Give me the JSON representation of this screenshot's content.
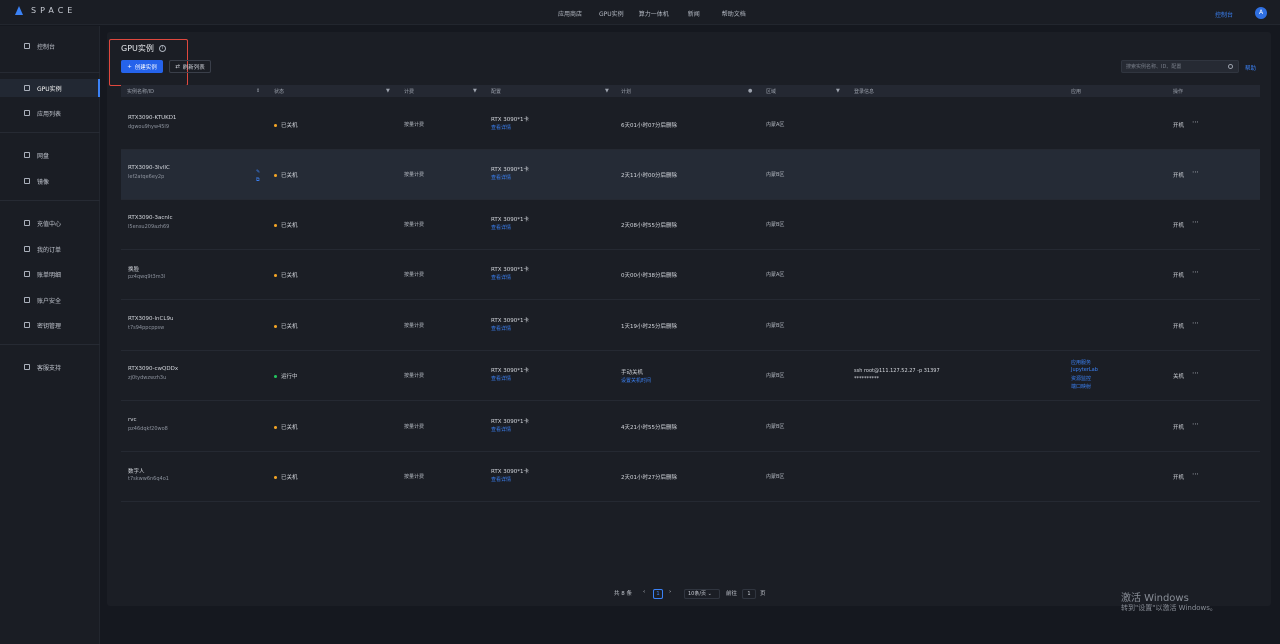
{
  "app": {
    "logo_text": "SPACE",
    "console_label": "控制台",
    "avatar_letter": "A"
  },
  "topnav": [
    "应用商店",
    "GPU实例",
    "算力一体机",
    "新闻",
    "帮助文档"
  ],
  "sidebar": {
    "items": [
      {
        "label": "控制台",
        "icon": "dashboard-icon"
      },
      {
        "label": "GPU实例",
        "icon": "gpu-icon"
      },
      {
        "label": "应用列表",
        "icon": "app-list-icon"
      },
      {
        "label": "网盘",
        "icon": "cloud-disk-icon"
      },
      {
        "label": "镜像",
        "icon": "image-icon"
      },
      {
        "label": "充值中心",
        "icon": "recharge-icon"
      },
      {
        "label": "我的订单",
        "icon": "order-icon"
      },
      {
        "label": "账单明细",
        "icon": "bill-icon"
      },
      {
        "label": "账户安全",
        "icon": "security-icon"
      },
      {
        "label": "密钥管理",
        "icon": "key-icon"
      },
      {
        "label": "客服支持",
        "icon": "support-icon"
      }
    ]
  },
  "page": {
    "title": "GPU实例",
    "create_label": "创建实例",
    "refresh_label": "刷新列表",
    "search_placeholder": "搜索实例名称、ID、配置",
    "help_label": "帮助"
  },
  "table": {
    "headers": [
      "实例名称/ID",
      "状态",
      "计费",
      "配置",
      "计划",
      "区域",
      "登录信息",
      "应用",
      "操作"
    ],
    "rows": [
      {
        "name": "RTX3090-KTUKD1",
        "id": "dgwou9hyw45l9",
        "status": "已关机",
        "status_color": "#f5a524",
        "billing": "按量计费",
        "config": "RTX 3090*1卡",
        "config_link": "查看详情",
        "plan": "6天01小时07分后删除",
        "plan_link": "",
        "region": "内蒙A区",
        "login": "",
        "login_pw": "",
        "apps": [],
        "action": "开机"
      },
      {
        "name": "RTX3090-3lvlIC",
        "id": "lef2atqe6ey2p",
        "status": "已关机",
        "status_color": "#f5a524",
        "billing": "按量计费",
        "config": "RTX 3090*1卡",
        "config_link": "查看详情",
        "plan": "2天11小时00分后删除",
        "plan_link": "",
        "region": "内蒙B区",
        "login": "",
        "login_pw": "",
        "apps": [],
        "action": "开机"
      },
      {
        "name": "RTX3090-3acnlc",
        "id": "l5ensu209azh69",
        "status": "已关机",
        "status_color": "#f5a524",
        "billing": "按量计费",
        "config": "RTX 3090*1卡",
        "config_link": "查看详情",
        "plan": "2天08小时55分后删除",
        "plan_link": "",
        "region": "内蒙B区",
        "login": "",
        "login_pw": "",
        "apps": [],
        "action": "开机"
      },
      {
        "name": "换脸",
        "id": "pz4qwq9t3m3l",
        "status": "已关机",
        "status_color": "#f5a524",
        "billing": "按量计费",
        "config": "RTX 3090*1卡",
        "config_link": "查看详情",
        "plan": "0天00小时38分后删除",
        "plan_link": "",
        "region": "内蒙A区",
        "login": "",
        "login_pw": "",
        "apps": [],
        "action": "开机"
      },
      {
        "name": "RTX3090-lnCL9u",
        "id": "t7s94ppcppsw",
        "status": "已关机",
        "status_color": "#f5a524",
        "billing": "按量计费",
        "config": "RTX 3090*1卡",
        "config_link": "查看详情",
        "plan": "1天19小时25分后删除",
        "plan_link": "",
        "region": "内蒙B区",
        "login": "",
        "login_pw": "",
        "apps": [],
        "action": "开机"
      },
      {
        "name": "RTX3090-cwQDDx",
        "id": "zj0tydwzwzh3u",
        "status": "运行中",
        "status_color": "#22c55e",
        "billing": "按量计费",
        "config": "RTX 3090*1卡",
        "config_link": "查看详情",
        "plan": "手动关机",
        "plan_link": "设置关机时间",
        "region": "内蒙B区",
        "login": "ssh root@111.127.52.27 -p 31397",
        "login_pw": "**********",
        "apps": [
          "应用服务",
          "JupyterLab",
          "资源监控",
          "端口映射"
        ],
        "action": "关机"
      },
      {
        "name": "rvc",
        "id": "pz46dqkf20wo8",
        "status": "已关机",
        "status_color": "#f5a524",
        "billing": "按量计费",
        "config": "RTX 3090*1卡",
        "config_link": "查看详情",
        "plan": "4天21小时55分后删除",
        "plan_link": "",
        "region": "内蒙B区",
        "login": "",
        "login_pw": "",
        "apps": [],
        "action": "开机"
      },
      {
        "name": "数字人",
        "id": "t7skww6n6q4o1",
        "status": "已关机",
        "status_color": "#f5a524",
        "billing": "按量计费",
        "config": "RTX 3090*1卡",
        "config_link": "查看详情",
        "plan": "2天01小时27分后删除",
        "plan_link": "",
        "region": "内蒙B区",
        "login": "",
        "login_pw": "",
        "apps": [],
        "action": "开机"
      }
    ]
  },
  "pagination": {
    "total": "共 8 条",
    "current": "1",
    "page_size": "10条/页",
    "goto_label": "前往",
    "goto_value": "1",
    "page_unit": "页"
  },
  "watermark": {
    "line1": "激活 Windows",
    "line2": "转到\"设置\"以激活 Windows。"
  }
}
